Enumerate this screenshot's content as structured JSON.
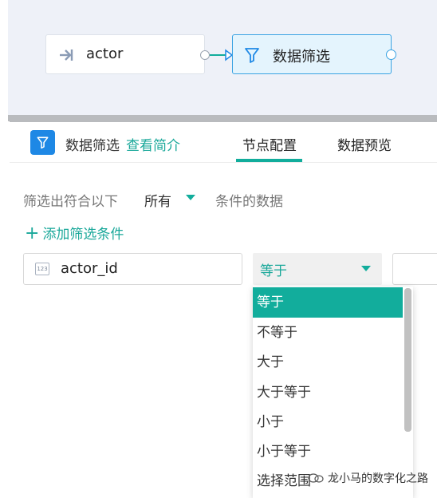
{
  "canvas": {
    "nodes": [
      {
        "label": "actor",
        "icon": "arrow-right-into-icon"
      },
      {
        "label": "数据筛选",
        "icon": "filter-icon"
      }
    ]
  },
  "panel": {
    "title": "数据筛选",
    "intro_link": "查看简介",
    "icon": "filter-icon",
    "tabs": [
      {
        "label": "节点配置",
        "active": true
      },
      {
        "label": "数据预览",
        "active": false
      }
    ]
  },
  "condition": {
    "prefix": "筛选出符合以下",
    "mode": "所有",
    "suffix": "条件的数据",
    "add_label": "添加筛选条件"
  },
  "rule": {
    "field_icon_text": "123",
    "field": "actor_id",
    "operator": "等于",
    "value": ""
  },
  "operator_options": [
    "等于",
    "不等于",
    "大于",
    "大于等于",
    "小于",
    "小于等于",
    "选择范围"
  ],
  "selected_option_index": 0,
  "watermark": "龙小马的数字化之路",
  "colors": {
    "accent": "#12ad9c",
    "brand_blue": "#1e88e5",
    "node_selected_bg": "#e4f4fd"
  }
}
